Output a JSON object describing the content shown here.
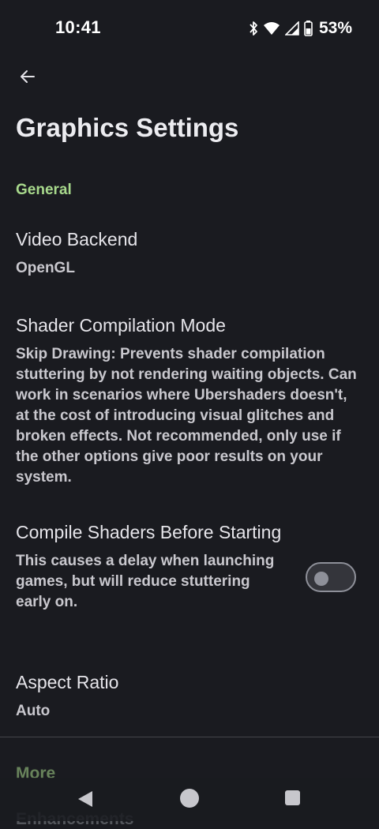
{
  "status_bar": {
    "time": "10:41",
    "battery": "53%",
    "icons": [
      "bluetooth-icon",
      "wifi-icon",
      "signal-icon",
      "battery-icon"
    ]
  },
  "header": {
    "back_icon": "arrow-left-icon",
    "title": "Graphics Settings"
  },
  "sections": {
    "general": "General",
    "more": "More",
    "enhancements": "Enhancements"
  },
  "settings": {
    "video_backend": {
      "title": "Video Backend",
      "summary": "OpenGL"
    },
    "shader_mode": {
      "title": "Shader Compilation Mode",
      "summary": "Skip Drawing: Prevents shader compilation stuttering by not rendering waiting objects. Can work in scenarios where Ubershaders doesn't, at the cost of introducing visual glitches and broken effects. Not recommended, only use if the other options give poor results on your system."
    },
    "compile_shaders": {
      "title": "Compile Shaders Before Starting",
      "summary": "This causes a delay when launching games, but will reduce stuttering early on.",
      "enabled": false
    },
    "aspect_ratio": {
      "title": "Aspect Ratio",
      "summary": "Auto"
    }
  },
  "colors": {
    "background": "#1a1b20",
    "accent": "#a8d98c",
    "text": "#e6e5ea",
    "summary_text": "#c9c8ce"
  },
  "nav_bar": {
    "icons": [
      "nav-back-icon",
      "nav-home-icon",
      "nav-recents-icon"
    ]
  }
}
